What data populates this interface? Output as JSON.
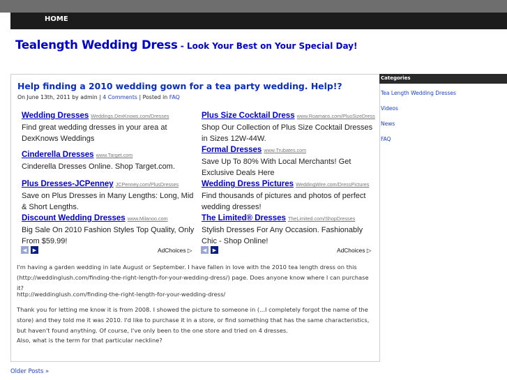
{
  "nav": {
    "home_label": "HOME"
  },
  "site": {
    "title": "Tealength Wedding Dress",
    "tagline": " - Look Your Best on Your Special Day!"
  },
  "post": {
    "title": "Help finding a 2010 wedding gown for a tea party wedding. Help!?",
    "meta_prefix": "On June 13th, 2011 by admin | ",
    "comments_link": "4 Comments",
    "meta_mid": " | Posted in ",
    "category_link": "FAQ",
    "paragraphs": [
      "I'm having a garden wedding in late August or September. I have fallen in love with the 2010 tea length dress on this (http://weddinglush.com/finding-the-right-length-for-your-wedding-dress/) page. Does anyone know where I can purchase it?",
      "http://weddinglush.com/finding-the-right-length-for-your-wedding-dress/",
      "Thank you for letting me know it is from 2008. I showed the picture to someone in (...I completely forgot the name of the store) and they told me it was 2010. I'd like to purchase it in a store, or find something that has the same characteristics, but haven't found anything. Of course, I've only been to the one store and tried on 4 dresses.",
      "Also, what is the term for that particular neckline?"
    ]
  },
  "ads": {
    "left": [
      {
        "title": "Wedding Dresses",
        "url": "Weddings.DexKnows.com/Dresses",
        "desc": "Find great wedding dresses in your area at DexKnows Weddings"
      },
      {
        "title": "Cinderella Dresses",
        "url": "www.Target.com",
        "desc": "Cinderella Dresses Online. Shop Target.com."
      },
      {
        "title": "Plus Dresses-JCPenney",
        "url": "JCPenney.com/PlusDresses",
        "desc": "Save on Plus Dresses in Many Lengths: Long, Mid & Short Lengths."
      },
      {
        "title": "Discount Wedding Dresses",
        "url": "www.Milanoo.com",
        "desc": "Big Sale On 2010 Fashion Styles Top Quality, Only From $59.99!"
      }
    ],
    "right": [
      {
        "title": "Plus Size Cocktail Dress",
        "url": "www.Roamans.com/PlusSizeDress",
        "desc": "Shop Our Collection of Plus Size Cocktail Dresses in Sizes 12W-44W."
      },
      {
        "title": "Formal Dresses",
        "url": "www.Trubates.com",
        "desc": "Save Up To 80% With Local Merchants! Get Exclusive Deals Here"
      },
      {
        "title": "Wedding Dress Pictures",
        "url": "WeddingWire.com/DressPictures",
        "desc": "Find thousands of pictures and photos of perfect wedding dresses!"
      },
      {
        "title": "The Limited® Dresses",
        "url": "TheLimited.com/ShopDresses",
        "desc": "Stylish Dresses For Any Occasion. Fashionably Chic - Shop Online!"
      }
    ],
    "adchoices_label": "AdChoices ▷",
    "prev_glyph": "◀",
    "next_glyph": "▶"
  },
  "sidebar": {
    "heading": "Categories",
    "items": [
      "Tea Length Wedding Dresses",
      "Videos",
      "News",
      "FAQ"
    ]
  },
  "footer": {
    "older_posts": "Older Posts »"
  }
}
